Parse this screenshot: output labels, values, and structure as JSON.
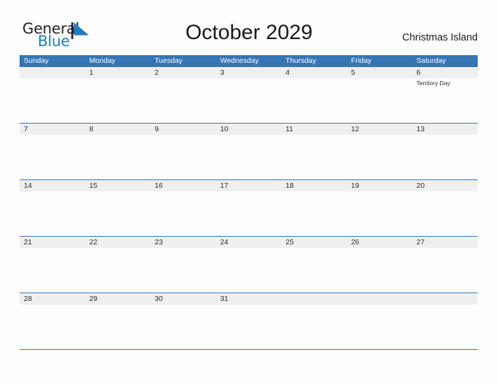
{
  "brand": {
    "name_part1": "General",
    "name_part2": "Blue",
    "flag_icon": "blue-triangle-flag-icon",
    "accent_color": "#1f7bc1"
  },
  "header": {
    "title": "October 2029",
    "location": "Christmas Island"
  },
  "colors": {
    "header_blue": "#3575b6",
    "row_band_gray": "#efefef",
    "row_border_blue": "#3575b6",
    "text_dark": "#2b2b2b",
    "page_background": "#fdfdfd"
  },
  "calendar": {
    "month": "October",
    "year": "2029",
    "weekday_headers": [
      "Sunday",
      "Monday",
      "Tuesday",
      "Wednesday",
      "Thursday",
      "Friday",
      "Saturday"
    ],
    "weeks": [
      [
        {
          "day": "",
          "events": []
        },
        {
          "day": "1",
          "events": []
        },
        {
          "day": "2",
          "events": []
        },
        {
          "day": "3",
          "events": []
        },
        {
          "day": "4",
          "events": []
        },
        {
          "day": "5",
          "events": []
        },
        {
          "day": "6",
          "events": [
            "Territory Day"
          ]
        }
      ],
      [
        {
          "day": "7",
          "events": []
        },
        {
          "day": "8",
          "events": []
        },
        {
          "day": "9",
          "events": []
        },
        {
          "day": "10",
          "events": []
        },
        {
          "day": "11",
          "events": []
        },
        {
          "day": "12",
          "events": []
        },
        {
          "day": "13",
          "events": []
        }
      ],
      [
        {
          "day": "14",
          "events": []
        },
        {
          "day": "15",
          "events": []
        },
        {
          "day": "16",
          "events": []
        },
        {
          "day": "17",
          "events": []
        },
        {
          "day": "18",
          "events": []
        },
        {
          "day": "19",
          "events": []
        },
        {
          "day": "20",
          "events": []
        }
      ],
      [
        {
          "day": "21",
          "events": []
        },
        {
          "day": "22",
          "events": []
        },
        {
          "day": "23",
          "events": []
        },
        {
          "day": "24",
          "events": []
        },
        {
          "day": "25",
          "events": []
        },
        {
          "day": "26",
          "events": []
        },
        {
          "day": "27",
          "events": []
        }
      ],
      [
        {
          "day": "28",
          "events": []
        },
        {
          "day": "29",
          "events": []
        },
        {
          "day": "30",
          "events": []
        },
        {
          "day": "31",
          "events": []
        },
        {
          "day": "",
          "events": []
        },
        {
          "day": "",
          "events": []
        },
        {
          "day": "",
          "events": []
        }
      ]
    ]
  }
}
